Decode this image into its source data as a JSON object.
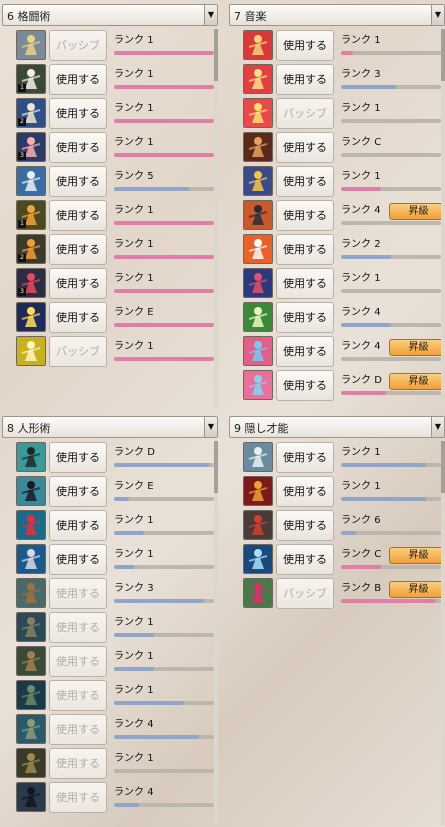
{
  "panels": [
    {
      "title": "6 格闘術",
      "skills": [
        {
          "icon": "fist-gold-icon",
          "bg": "#7a8a98",
          "glyph": "#e8d18a",
          "button": "パッシブ",
          "passive": true,
          "rank_label": "ランク",
          "rank": "1",
          "progress": 1.0,
          "fill": "pink"
        },
        {
          "icon": "dodge-stance-icon",
          "bg": "#3b4a32",
          "glyph": "#f0f0f0",
          "badge": "1",
          "button": "使用する",
          "passive": false,
          "rank_label": "ランク",
          "rank": "1",
          "progress": 1.0,
          "fill": "pink"
        },
        {
          "icon": "spin-kick-icon",
          "bg": "#2f4f8a",
          "glyph": "#f0e6c8",
          "badge": "2",
          "button": "使用する",
          "passive": false,
          "rank_label": "ランク",
          "rank": "1",
          "progress": 1.0,
          "fill": "pink"
        },
        {
          "icon": "combo-strike-icon",
          "bg": "#2d3a66",
          "glyph": "#f4b0b0",
          "badge": "3",
          "button": "使用する",
          "passive": false,
          "rank_label": "ランク",
          "rank": "1",
          "progress": 1.0,
          "fill": "pink"
        },
        {
          "icon": "leap-kick-icon",
          "bg": "#3a6da4",
          "glyph": "#e8f0f8",
          "button": "使用する",
          "passive": false,
          "rank_label": "ランク",
          "rank": "5",
          "progress": 0.75,
          "fill": "blue"
        },
        {
          "icon": "fire-punch-icon",
          "bg": "#4a4a20",
          "glyph": "#f2a23a",
          "badge": "1",
          "button": "使用する",
          "passive": false,
          "rank_label": "ランク",
          "rank": "1",
          "progress": 1.0,
          "fill": "pink"
        },
        {
          "icon": "rising-flame-icon",
          "bg": "#3b3b2a",
          "glyph": "#f29c3a",
          "badge": "2",
          "button": "使用する",
          "passive": false,
          "rank_label": "ランク",
          "rank": "1",
          "progress": 1.0,
          "fill": "pink"
        },
        {
          "icon": "red-dash-icon",
          "bg": "#2c2c44",
          "glyph": "#e84a5a",
          "badge": "3",
          "button": "使用する",
          "passive": false,
          "rank_label": "ランク",
          "rank": "1",
          "progress": 1.0,
          "fill": "pink"
        },
        {
          "icon": "exp-burst-icon",
          "bg": "#1d2a5a",
          "glyph": "#ffde5a",
          "button": "使用する",
          "passive": false,
          "rank_label": "ランク",
          "rank": "E",
          "progress": 1.0,
          "fill": "pink"
        },
        {
          "icon": "yellow-fighter-icon",
          "bg": "#c8b020",
          "glyph": "#fff8c0",
          "button": "パッシブ",
          "passive": true,
          "rank_label": "ランク",
          "rank": "1",
          "progress": 1.0,
          "fill": "pink"
        }
      ]
    },
    {
      "title": "7 音楽",
      "skills": [
        {
          "icon": "lute-icon",
          "bg": "#d83a3a",
          "glyph": "#f6d07a",
          "button": "使用する",
          "passive": false,
          "rank_label": "ランク",
          "rank": "1",
          "progress": 0.12,
          "fill": "pink"
        },
        {
          "icon": "guitar-icon",
          "bg": "#e24040",
          "glyph": "#f8e08a",
          "button": "使用する",
          "passive": false,
          "rank_label": "ランク",
          "rank": "3",
          "progress": 0.55,
          "fill": "blue"
        },
        {
          "icon": "music-note-icon",
          "bg": "#e84a4a",
          "glyph": "#fde070",
          "button": "パッシブ",
          "passive": true,
          "rank_label": "ランク",
          "rank": "1",
          "progress": 0.0,
          "fill": "pink"
        },
        {
          "icon": "dark-performer-icon",
          "bg": "#5a2a1a",
          "glyph": "#e8a060",
          "button": "使用する",
          "passive": false,
          "rank_label": "ランク",
          "rank": "C",
          "progress": 0.0,
          "fill": "pink"
        },
        {
          "icon": "golden-horn-icon",
          "bg": "#3a4a8a",
          "glyph": "#f2c448",
          "button": "使用する",
          "passive": false,
          "rank_label": "ランク",
          "rank": "1",
          "progress": 0.4,
          "fill": "pink"
        },
        {
          "icon": "shield-cross-icon",
          "bg": "#c85a2a",
          "glyph": "#2a2a3a",
          "button": "使用する",
          "passive": false,
          "rank_label": "ランク",
          "rank": "4",
          "progress": 0.0,
          "fill": "pink",
          "upgrade": "昇級"
        },
        {
          "icon": "sleep-spirit-icon",
          "bg": "#e8602a",
          "glyph": "#f8f8f8",
          "button": "使用する",
          "passive": false,
          "rank_label": "ランク",
          "rank": "2",
          "progress": 0.5,
          "fill": "blue"
        },
        {
          "icon": "crossed-swords-icon",
          "bg": "#2a3a7a",
          "glyph": "#e05070",
          "button": "使用する",
          "passive": false,
          "rank_label": "ランク",
          "rank": "1",
          "progress": 0.0,
          "fill": "pink"
        },
        {
          "icon": "green-figure-icon",
          "bg": "#3a8a3a",
          "glyph": "#eaf8c0",
          "button": "使用する",
          "passive": false,
          "rank_label": "ランク",
          "rank": "4",
          "progress": 0.5,
          "fill": "blue"
        },
        {
          "icon": "dancer-blue-icon",
          "bg": "#e06088",
          "glyph": "#7ac8f0",
          "button": "使用する",
          "passive": false,
          "rank_label": "ランク",
          "rank": "4",
          "progress": 0.0,
          "fill": "pink",
          "upgrade": "昇級"
        },
        {
          "icon": "dancer-pink-icon",
          "bg": "#e8709a",
          "glyph": "#8ad0f0",
          "button": "使用する",
          "passive": false,
          "rank_label": "ランク",
          "rank": "D",
          "progress": 0.45,
          "fill": "pink",
          "upgrade": "昇級"
        }
      ]
    },
    {
      "title": "8 人形術",
      "skills": [
        {
          "icon": "puppet-hat-icon",
          "bg": "#3a9a9a",
          "glyph": "#1e2a2a",
          "button": "使用する",
          "passive": false,
          "rank_label": "ランク",
          "rank": "D",
          "progress": 0.95,
          "fill": "blue"
        },
        {
          "icon": "puppet-dark-icon",
          "bg": "#3a8a9a",
          "glyph": "#1a1a2a",
          "button": "使用する",
          "passive": false,
          "rank_label": "ランク",
          "rank": "E",
          "progress": 0.15,
          "fill": "blue"
        },
        {
          "icon": "red-hair-doll-icon",
          "bg": "#1a6a8a",
          "glyph": "#e03040",
          "button": "使用する",
          "passive": false,
          "rank_label": "ランク",
          "rank": "1",
          "progress": 0.3,
          "fill": "blue"
        },
        {
          "icon": "armored-doll-icon",
          "bg": "#1a5a8a",
          "glyph": "#d8d8e8",
          "button": "使用する",
          "passive": false,
          "rank_label": "ランク",
          "rank": "1",
          "progress": 0.2,
          "fill": "blue"
        },
        {
          "icon": "wooden-cross-icon",
          "bg": "#4a6a6a",
          "glyph": "#a07040",
          "button": "使用する",
          "passive": true,
          "rank_label": "ランク",
          "rank": "3",
          "progress": 0.9,
          "fill": "blue"
        },
        {
          "icon": "shadow-doll-icon",
          "bg": "#2a4a5a",
          "glyph": "#8a8060",
          "button": "使用する",
          "passive": true,
          "rank_label": "ランク",
          "rank": "1",
          "progress": 0.4,
          "fill": "blue"
        },
        {
          "icon": "bronze-doll-icon",
          "bg": "#3a4a3a",
          "glyph": "#a08050",
          "button": "使用する",
          "passive": true,
          "rank_label": "ランク",
          "rank": "1",
          "progress": 0.4,
          "fill": "blue"
        },
        {
          "icon": "marionette-icon",
          "bg": "#1a3a4a",
          "glyph": "#6a8a6a",
          "button": "使用する",
          "passive": true,
          "rank_label": "ランク",
          "rank": "1",
          "progress": 0.7,
          "fill": "blue"
        },
        {
          "icon": "golem-doll-icon",
          "bg": "#2a5a6a",
          "glyph": "#8a9a7a",
          "button": "使用する",
          "passive": true,
          "rank_label": "ランク",
          "rank": "4",
          "progress": 0.85,
          "fill": "blue"
        },
        {
          "icon": "beast-doll-icon",
          "bg": "#3a3a2a",
          "glyph": "#a08a4a",
          "button": "使用する",
          "passive": true,
          "rank_label": "ランク",
          "rank": "1",
          "progress": 0.0,
          "fill": "blue"
        },
        {
          "icon": "black-knight-icon",
          "bg": "#2a3a4a",
          "glyph": "#101820",
          "button": "使用する",
          "passive": true,
          "rank_label": "ランク",
          "rank": "4",
          "progress": 0.25,
          "fill": "blue"
        }
      ]
    },
    {
      "title": "9 隠し才能",
      "skills": [
        {
          "icon": "spirit-form-icon",
          "bg": "#6a8aa0",
          "glyph": "#e8f0f0",
          "button": "使用する",
          "passive": false,
          "rank_label": "ランク",
          "rank": "1",
          "progress": 0.85,
          "fill": "blue"
        },
        {
          "icon": "demon-face-icon",
          "bg": "#7a1a1a",
          "glyph": "#f0a030",
          "button": "使用する",
          "passive": false,
          "rank_label": "ランク",
          "rank": "1",
          "progress": 0.85,
          "fill": "blue"
        },
        {
          "icon": "fighter-red-icon",
          "bg": "#4a3a3a",
          "glyph": "#d04030",
          "button": "使用する",
          "passive": false,
          "rank_label": "ランク",
          "rank": "6",
          "progress": 0.15,
          "fill": "blue"
        },
        {
          "icon": "blue-water-icon",
          "bg": "#1a4a7a",
          "glyph": "#a8e0f8",
          "button": "使用する",
          "passive": false,
          "rank_label": "ランク",
          "rank": "C",
          "progress": 0.4,
          "fill": "pink",
          "upgrade": "昇級"
        },
        {
          "icon": "potion-flask-icon",
          "bg": "#4a7a4a",
          "glyph": "#d8306a",
          "button": "パッシブ",
          "passive": true,
          "rank_label": "ランク",
          "rank": "B",
          "progress": 0.95,
          "fill": "pink",
          "upgrade": "昇級"
        }
      ]
    }
  ],
  "dropdown_glyph": "▼"
}
